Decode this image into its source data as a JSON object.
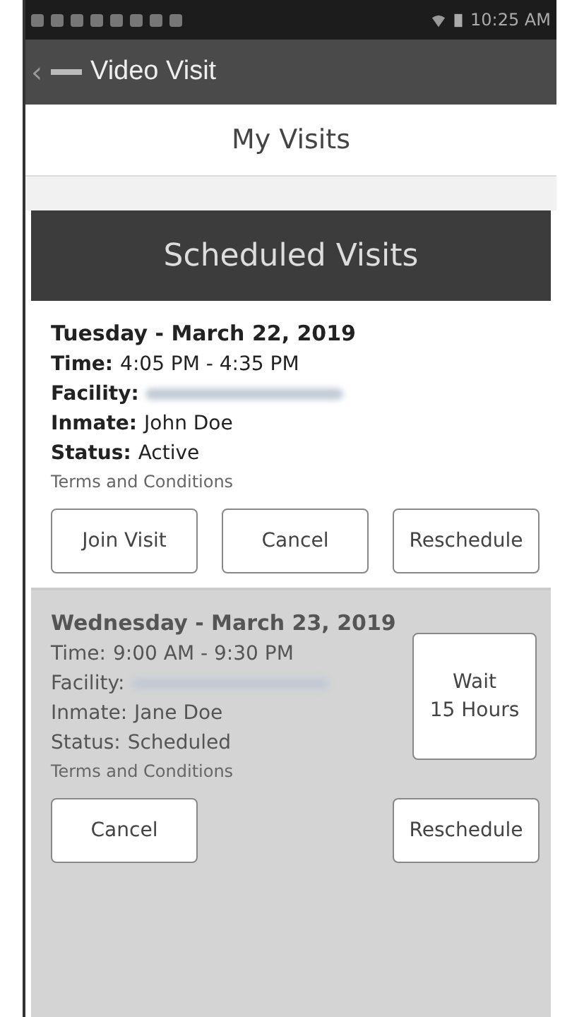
{
  "status_bar": {
    "time": "10:25 AM"
  },
  "app_bar": {
    "back": "‹",
    "title": "Video Visit"
  },
  "page_title": "My Visits",
  "section_title": "Scheduled Visits",
  "visits": [
    {
      "active": true,
      "date": "Tuesday - March 22,  2019",
      "fields": [
        {
          "label": "Time:",
          "value": "4:05 PM - 4:35 PM"
        },
        {
          "label": "Facility:",
          "redacted": true
        },
        {
          "label": "Inmate:",
          "value": "John Doe"
        },
        {
          "label": "Status:",
          "value": "Active"
        }
      ],
      "terms": "Terms and Conditions",
      "buttons": [
        "Join Visit",
        "Cancel",
        "Reschedule"
      ]
    },
    {
      "active": false,
      "date": "Wednesday - March 23,  2019",
      "fields": [
        {
          "label": "Time:",
          "value": "9:00 AM - 9:30 PM"
        },
        {
          "label": "Facility:",
          "redacted": true
        },
        {
          "label": "Inmate:",
          "value": "Jane Doe"
        },
        {
          "label": "Status:",
          "value": "Scheduled"
        }
      ],
      "terms": "Terms and Conditions",
      "wait": [
        "Wait",
        "15 Hours"
      ],
      "buttons": [
        "Cancel",
        "Reschedule"
      ]
    }
  ]
}
